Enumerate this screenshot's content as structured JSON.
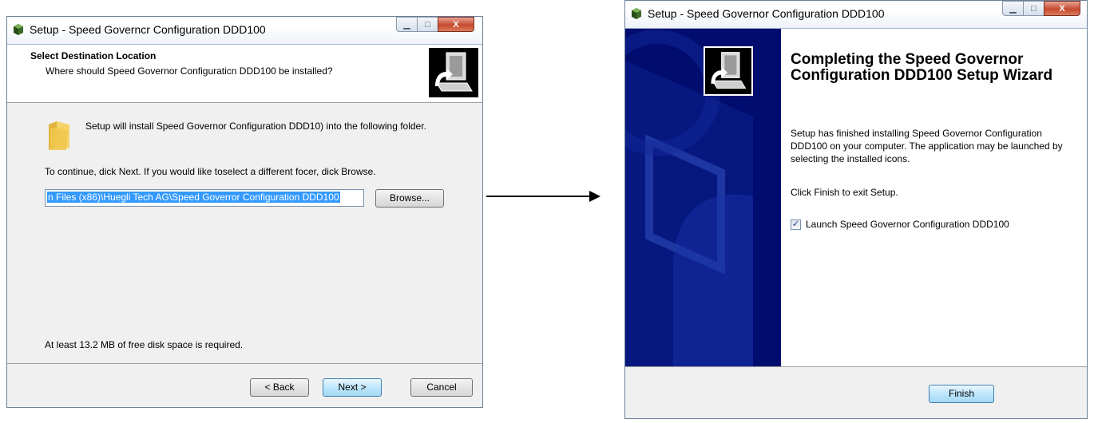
{
  "window1": {
    "title": "Setup - Speed Governcr Configuration DDD100",
    "header": {
      "title": "Select Destination Location",
      "subtitle": "Where should Speed Governor Configuraticn DDD100 be installed?"
    },
    "intro_text": "Setup will install Speed Governor Configuration DDD10) into the following folder.",
    "continue_text": "To continue, dick Next. If you would like toselect a different focer, dick Browse.",
    "path_value": "n Files (x86)\\Huegli Tech AG\\Speed Goverror Configuration DDD100",
    "browse_label": "Browse...",
    "space_text": "At least 13.2 MB of free disk space is required.",
    "back_label": "< Back",
    "next_label": "Next >",
    "cancel_label": "Cancel"
  },
  "window2": {
    "title": "Setup - Speed Governor Configuration DDD100",
    "heading": "Completing the Speed Governor Configuration DDD100 Setup Wizard",
    "body_text": "Setup has finished installing Speed Governor Configuration DDD100 on your computer. The application may be launched by selecting the installed icons.",
    "exit_text": "Click Finish to exit Setup.",
    "launch_label": "Launch Speed Governor Configuration DDD100",
    "launch_checked": true,
    "finish_label": "Finish"
  },
  "caption_buttons": {
    "minimize": "▁",
    "maximize": "□",
    "close": "X"
  },
  "colors": {
    "side_panel": "#000c6e",
    "selection": "#3399ff"
  }
}
